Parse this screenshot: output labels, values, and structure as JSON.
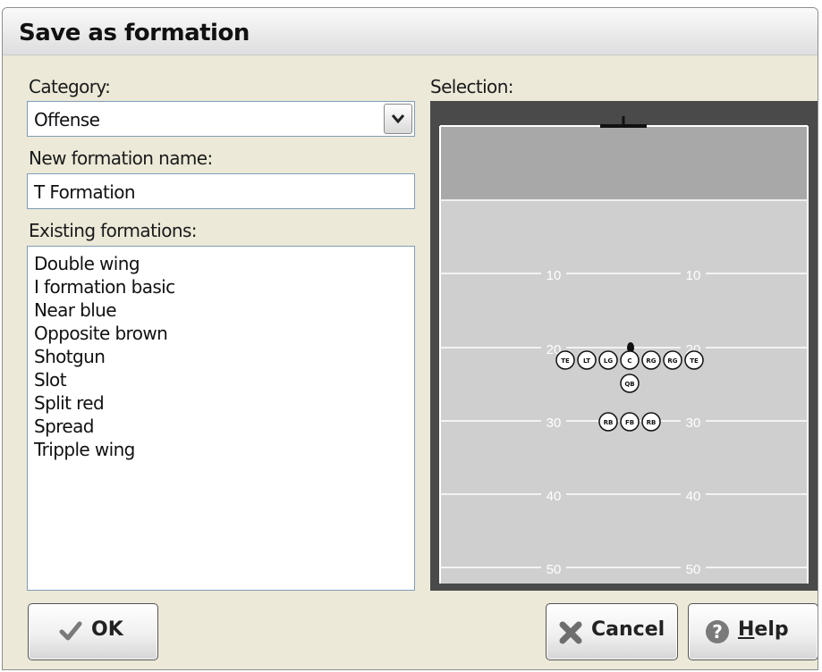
{
  "dialog": {
    "title": "Save as formation",
    "category_label": "Category:",
    "category_value": "Offense",
    "name_label": "New formation name:",
    "name_value": "T Formation",
    "existing_label": "Existing formations:",
    "existing_items": [
      "Double wing",
      "I formation basic",
      "Near blue",
      "Opposite brown",
      "Shotgun",
      "Slot",
      "Split red",
      "Spread",
      "Tripple wing"
    ],
    "selection_label": "Selection:"
  },
  "field": {
    "yard_labels": [
      "10",
      "20",
      "30",
      "40",
      "50"
    ],
    "players_line": [
      "TE",
      "LT",
      "LG",
      "C",
      "RG",
      "RG",
      "TE"
    ],
    "player_qb": "QB",
    "players_backs": [
      "RB",
      "FB",
      "RB"
    ]
  },
  "buttons": {
    "ok_label": "OK",
    "cancel_label": "Cancel",
    "help_prefix": "H",
    "help_rest": "elp"
  },
  "icons": {
    "ok": "checkmark-icon",
    "cancel": "cancel-x-icon",
    "help": "help-question-icon",
    "dropdown": "chevron-down-icon"
  }
}
